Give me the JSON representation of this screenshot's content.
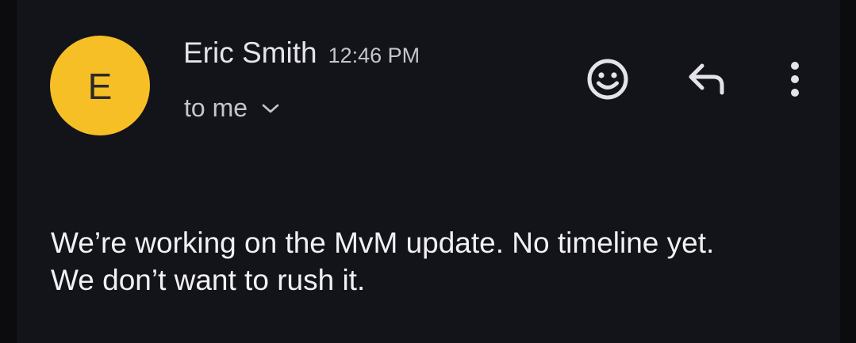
{
  "message": {
    "avatar_letter": "E",
    "sender_name": "Eric Smith",
    "timestamp": "12:46 PM",
    "recipient_label": "to me",
    "body_lines": [
      "We’re working on the MvM update. No timeline yet.",
      "We don’t want to rush it."
    ]
  },
  "actions": {
    "emoji_icon": "smiley-face-icon",
    "reply_icon": "reply-icon",
    "more_icon": "more-vertical-icon"
  },
  "colors": {
    "avatar_bg": "#f6bf26",
    "panel_bg": "#13131a",
    "outer_bg": "#0c0c0f"
  }
}
